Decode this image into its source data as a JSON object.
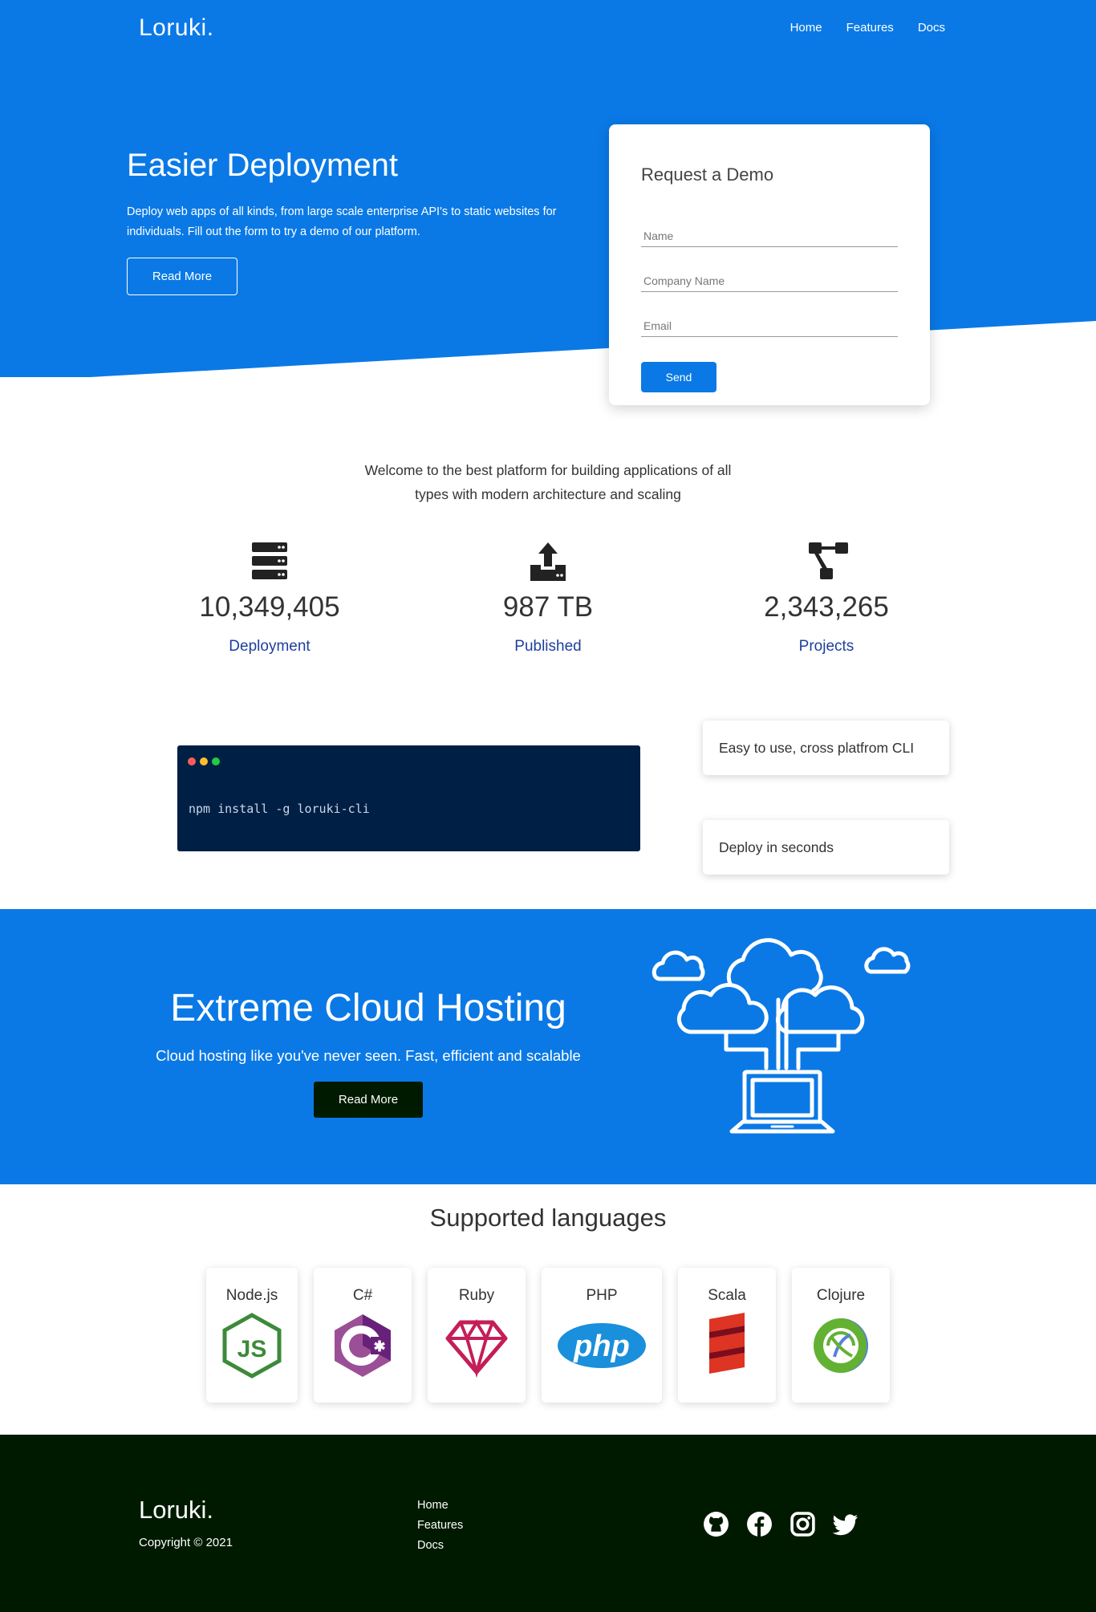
{
  "colors": {
    "primary": "#0a79e6",
    "dark": "#001a00",
    "terminal_bg": "#001f45",
    "stat_label": "#1d3fa0"
  },
  "nav": {
    "logo": "Loruki.",
    "links": [
      "Home",
      "Features",
      "Docs"
    ]
  },
  "hero": {
    "title": "Easier Deployment",
    "description": "Deploy web apps of all kinds, from large scale enterprise API's to static websites for individuals. Fill out the form to try a demo of our platform.",
    "button": "Read More"
  },
  "demo_form": {
    "title": "Request a Demo",
    "fields": [
      {
        "placeholder": "Name",
        "value": ""
      },
      {
        "placeholder": "Company Name",
        "value": ""
      },
      {
        "placeholder": "Email",
        "value": ""
      }
    ],
    "submit": "Send"
  },
  "welcome": "Welcome to the best platform for building applications of all types with modern architecture and scaling",
  "stats": [
    {
      "icon": "server-icon",
      "value": "10,349,405",
      "label": "Deployment"
    },
    {
      "icon": "upload-icon",
      "value": "987 TB",
      "label": "Published"
    },
    {
      "icon": "project-diagram-icon",
      "value": "2,343,265",
      "label": "Projects"
    }
  ],
  "terminal": {
    "command": "npm install -g loruki-cli"
  },
  "features": [
    "Easy to use, cross platfrom CLI",
    "Deploy in seconds"
  ],
  "cloud": {
    "title": "Extreme Cloud Hosting",
    "description": "Cloud hosting like you've never seen. Fast, efficient and scalable",
    "button": "Read More"
  },
  "languages": {
    "title": "Supported languages",
    "items": [
      {
        "name": "Node.js",
        "icon": "nodejs-logo"
      },
      {
        "name": "C#",
        "icon": "csharp-logo"
      },
      {
        "name": "Ruby",
        "icon": "ruby-logo"
      },
      {
        "name": "PHP",
        "icon": "php-logo"
      },
      {
        "name": "Scala",
        "icon": "scala-logo"
      },
      {
        "name": "Clojure",
        "icon": "clojure-logo"
      }
    ]
  },
  "footer": {
    "logo": "Loruki.",
    "copyright": "Copyright © 2021",
    "links": [
      "Home",
      "Features",
      "Docs"
    ],
    "socials": [
      "github-icon",
      "facebook-icon",
      "instagram-icon",
      "twitter-icon"
    ]
  }
}
